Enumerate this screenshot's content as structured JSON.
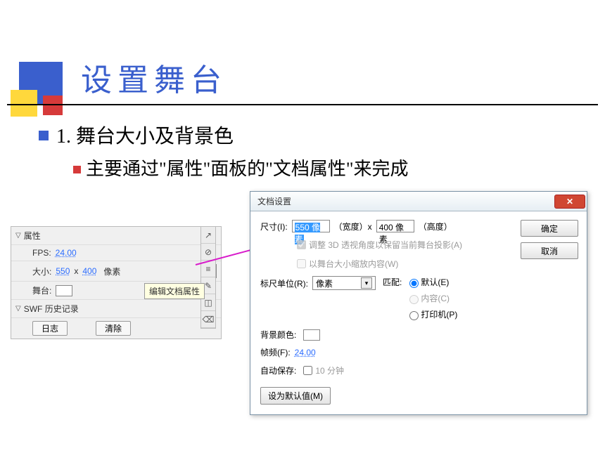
{
  "slide": {
    "title": "设置舞台",
    "section1_num": "1.",
    "section1_text": "舞台大小及背景色",
    "section2_text": "主要通过\"属性\"面板的\"文档属性\"来完成"
  },
  "prop_panel": {
    "group_props": "属性",
    "fps_label": "FPS:",
    "fps_value": "24.00",
    "size_label": "大小:",
    "width": "550",
    "x": "x",
    "height": "400",
    "unit": "像素",
    "stage_label": "舞台:",
    "group_swf": "SWF 历史记录",
    "btn_log": "日志",
    "btn_clear": "清除",
    "tooltip": "编辑文档属性"
  },
  "dialog": {
    "title": "文档设置",
    "dim_label": "尺寸(I):",
    "dim_width": "550 像素",
    "dim_wlabel": "（宽度）x",
    "dim_height": "400 像素",
    "dim_hlabel": "（高度）",
    "chk_3d": "调整 3D 透视角度以保留当前舞台投影(A)",
    "chk_scale": "以舞台大小缩放内容(W)",
    "ruler_label": "标尺单位(R):",
    "ruler_value": "像素",
    "match_label": "匹配:",
    "match_default": "默认(E)",
    "match_content": "内容(C)",
    "match_printer": "打印机(P)",
    "bg_label": "背景颜色:",
    "fps_label": "帧频(F):",
    "fps_value": "24.00",
    "autosave_label": "自动保存:",
    "autosave_val": "10 分钟",
    "btn_default": "设为默认值(M)",
    "btn_ok": "确定",
    "btn_cancel": "取消"
  }
}
